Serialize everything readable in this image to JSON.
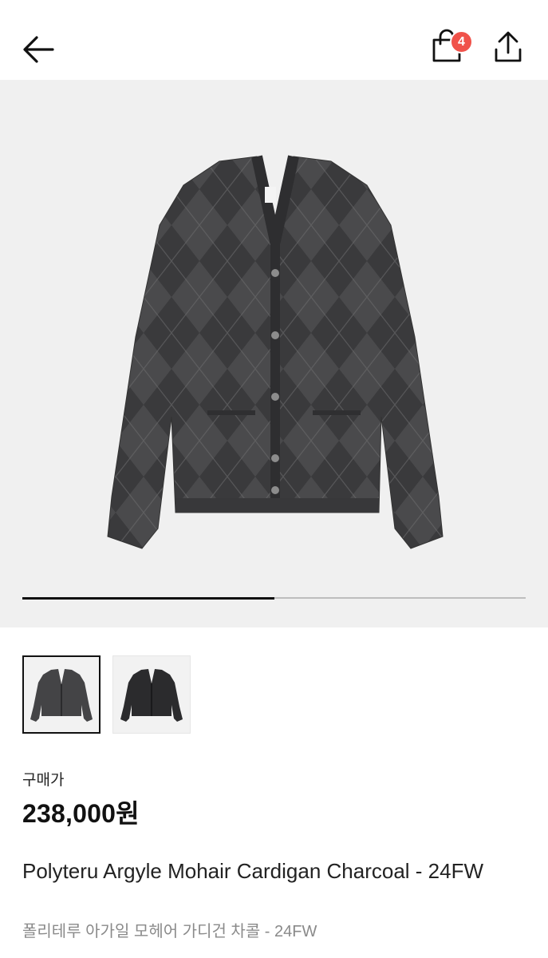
{
  "header": {
    "back_icon": "arrow-left-icon",
    "cart_icon": "shopping-bag-icon",
    "cart_count": "4",
    "share_icon": "share-upload-icon",
    "badge_color": "#f0524a"
  },
  "gallery": {
    "main_image": "charcoal-argyle-cardigan-front",
    "image_progress": 0.5,
    "thumbnails": [
      {
        "name": "charcoal-argyle-cardigan-front",
        "selected": true
      },
      {
        "name": "charcoal-cardigan-alt-view",
        "selected": false
      }
    ]
  },
  "product": {
    "price_label": "구매가",
    "price": "238,000원",
    "name_en": "Polyteru Argyle Mohair Cardigan Charcoal - 24FW",
    "name_ko": "폴리테루 아가일 모헤어 가디건 차콜 - 24FW"
  }
}
